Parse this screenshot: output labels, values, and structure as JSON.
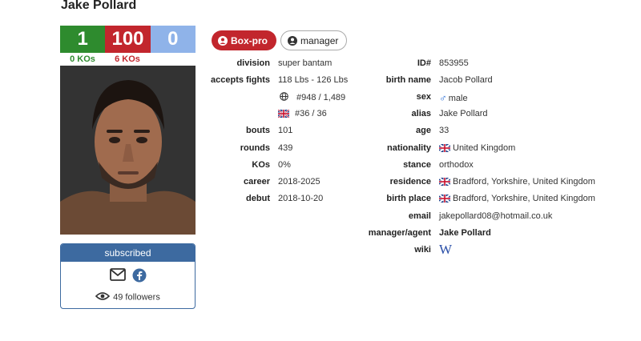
{
  "boxer": {
    "name": "Jake Pollard",
    "record": {
      "wins": "1",
      "losses": "100",
      "draws": "0"
    },
    "ko_wins": "0 KOs",
    "ko_losses": "6 KOs",
    "colors": {
      "win": "#2e8b2e",
      "loss": "#c2262d",
      "draw": "#8fb3e9"
    }
  },
  "follow": {
    "header": "subscribed",
    "followers": "49 followers",
    "icons": [
      "envelope-icon",
      "facebook-icon",
      "eye-icon"
    ]
  },
  "badges": {
    "pro": "Box-pro",
    "manager": "manager"
  },
  "left": {
    "division_label": "division",
    "division": "super bantam",
    "accepts_label": "accepts fights",
    "accepts": "118 Lbs - 126 Lbs",
    "rank_world": "#948 / 1,489",
    "rank_uk": "#36 / 36",
    "bouts_label": "bouts",
    "bouts": "101",
    "rounds_label": "rounds",
    "rounds": "439",
    "kos_label": "KOs",
    "kos": "0%",
    "career_label": "career",
    "career": "2018-2025",
    "debut_label": "debut",
    "debut": "2018-10-20"
  },
  "right": {
    "id_label": "ID#",
    "id": "853955",
    "birthname_label": "birth name",
    "birthname": "Jacob Pollard",
    "sex_label": "sex",
    "sex": "male",
    "alias_label": "alias",
    "alias": "Jake Pollard",
    "age_label": "age",
    "age": "33",
    "nationality_label": "nationality",
    "nationality": "United Kingdom",
    "stance_label": "stance",
    "stance": "orthodox",
    "residence_label": "residence",
    "residence": "Bradford, Yorkshire, United Kingdom",
    "birthplace_label": "birth place",
    "birthplace": "Bradford, Yorkshire, United Kingdom",
    "email_label": "email",
    "email": "jakepollard08@hotmail.co.uk",
    "manager_label": "manager/agent",
    "manager": "Jake Pollard",
    "wiki_label": "wiki",
    "wiki": "W"
  }
}
